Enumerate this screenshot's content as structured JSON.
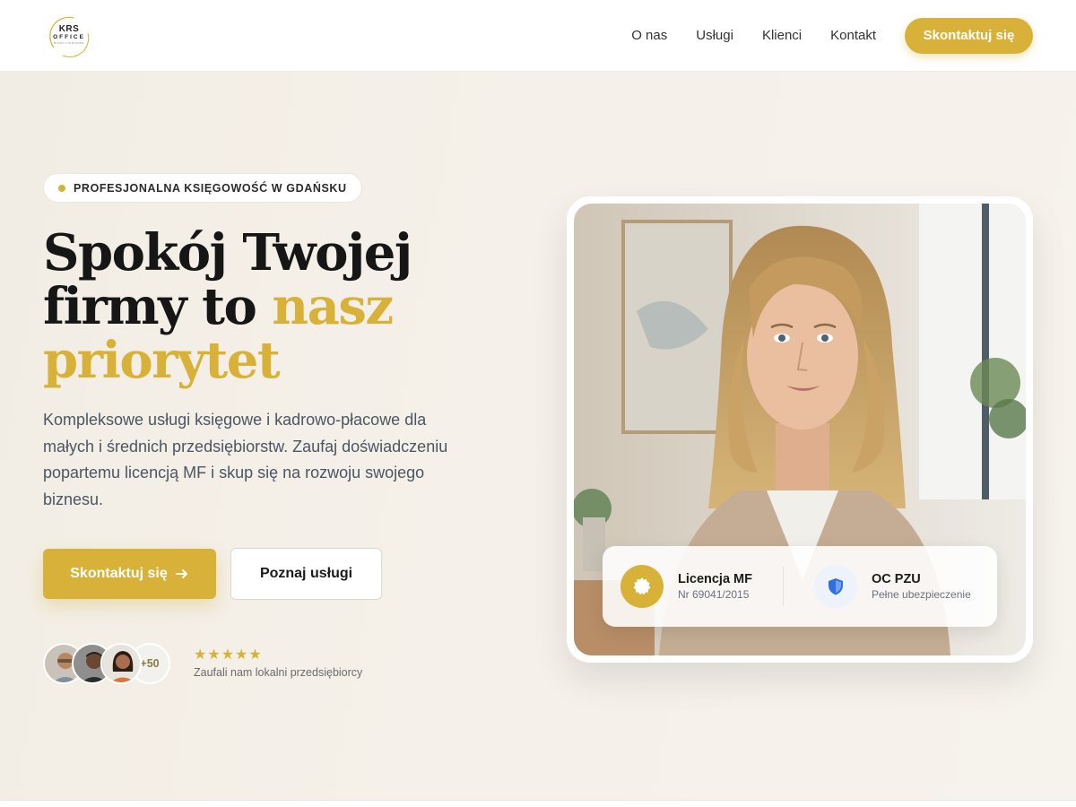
{
  "logo": {
    "line1": "KRS",
    "line2": "OFFICE",
    "line3": "BIURO KSIĘGOWE",
    "icon": "logo-mark"
  },
  "nav": {
    "items": [
      {
        "label": "O nas"
      },
      {
        "label": "Usługi"
      },
      {
        "label": "Klienci"
      },
      {
        "label": "Kontakt"
      }
    ],
    "cta_label": "Skontaktuj się"
  },
  "hero": {
    "badge": "PROFESJONALNA KSIĘGOWOŚĆ W GDAŃSKU",
    "title_part1": "Spokój Twojej firmy to ",
    "title_accent": "nasz priorytet",
    "description": "Kompleksowe usługi księgowe i kadrowo-płacowe dla małych i średnich przedsiębiorstw. Zaufaj doświadczeniu popartemu licencją MF i skup się na rozwoju swojego biznesu.",
    "primary_button": "Skontaktuj się",
    "primary_button_icon": "arrow-right-icon",
    "secondary_button": "Poznaj usługi",
    "avatars_more": "+50",
    "stars": "★★★★★",
    "rating_text": "Zaufali nam lokalni przedsiębiorcy"
  },
  "info_panel": {
    "license_title": "Licencja MF",
    "license_sub": "Nr 69041/2015",
    "license_icon": "seal-badge-icon",
    "insurance_title": "OC PZU",
    "insurance_sub": "Pełne ubezpieczenie",
    "insurance_icon": "shield-icon"
  },
  "colors": {
    "accent": "#d8b138",
    "hero_bg": "#f4efe8",
    "text_dark": "#161616",
    "text_muted": "#4b5563",
    "shield_blue": "#2f6fe0"
  }
}
